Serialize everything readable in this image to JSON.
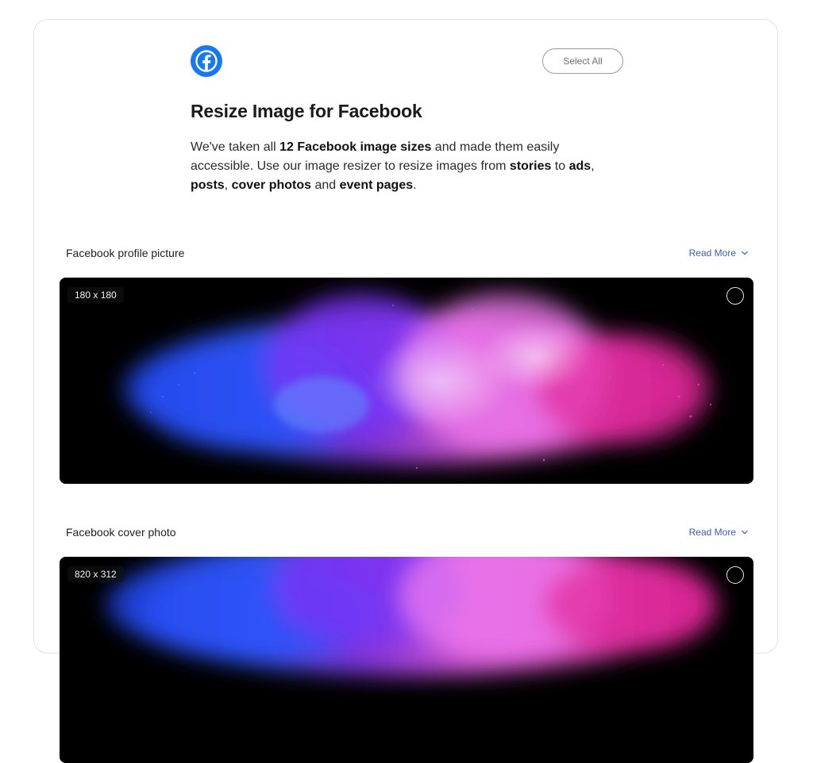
{
  "header": {
    "logo_icon": "facebook-logo-icon",
    "brand_color": "#1877F2",
    "select_all_label": "Select All",
    "title": "Resize Image for Facebook",
    "description": {
      "p1": "We've taken all ",
      "b1": "12 Facebook image sizes",
      "p2": " and made them easily accessible. Use our image resizer to resize images from ",
      "b2": "stories",
      "p3": " to ",
      "b3": "ads",
      "p4": ", ",
      "b4": "posts",
      "p5": ", ",
      "b5": "cover photos",
      "p6": " and ",
      "b6": "event pages",
      "p7": "."
    }
  },
  "sections": [
    {
      "title": "Facebook profile picture",
      "read_more": "Read More",
      "dimensions": "180 x 180"
    },
    {
      "title": "Facebook cover photo",
      "read_more": "Read More",
      "dimensions": "820 x 312"
    }
  ],
  "colors": {
    "link": "#3B5BCC",
    "border": "#E3E3E6"
  }
}
